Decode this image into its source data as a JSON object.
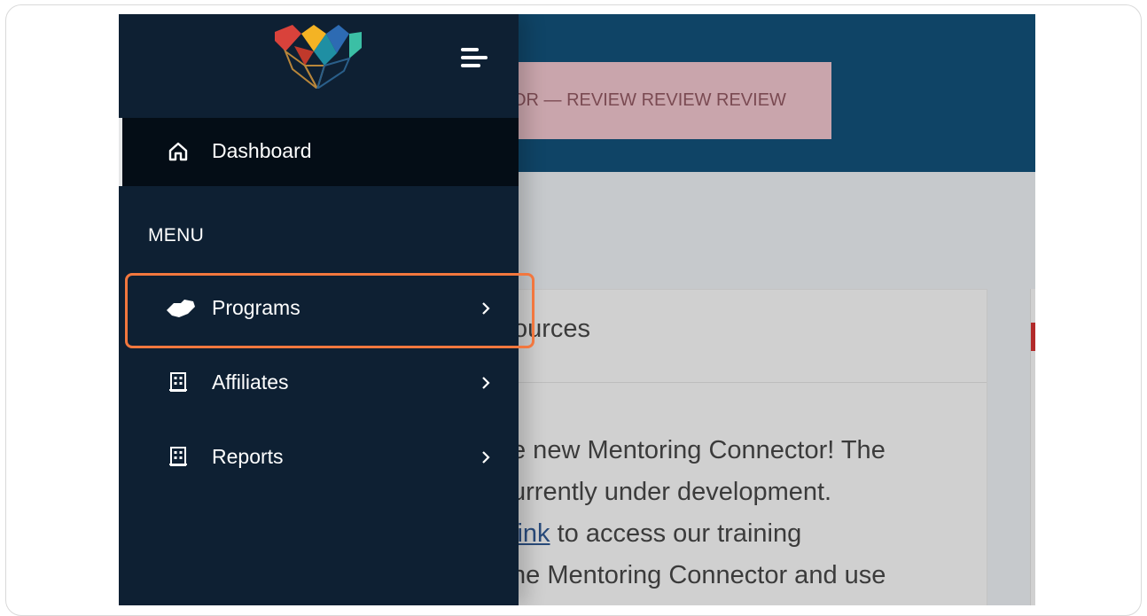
{
  "banner": {
    "text": "OR — REVIEW REVIEW REVIEW"
  },
  "card": {
    "title": "ources",
    "lines": [
      {
        "before": "",
        "link": "",
        "after": "e new Mentoring Connector! The"
      },
      {
        "before": "",
        "link": "",
        "after": "urrently under development."
      },
      {
        "before": "",
        "link": " link",
        "after": " to access our training"
      },
      {
        "before": "",
        "link": "",
        "after": "ne Mentoring Connector and use"
      }
    ]
  },
  "sidebar": {
    "dashboard": {
      "label": "Dashboard",
      "icon": "home-icon"
    },
    "menu_heading": "MENU",
    "items": [
      {
        "label": "Programs",
        "icon": "handshake-icon"
      },
      {
        "label": "Affiliates",
        "icon": "building-icon"
      },
      {
        "label": "Reports",
        "icon": "building-icon"
      }
    ]
  },
  "colors": {
    "sidebar_bg": "#0e2033",
    "topbar_bg": "#0f4466",
    "highlight": "#f2773e",
    "banner_bg": "#c9a5ac"
  }
}
